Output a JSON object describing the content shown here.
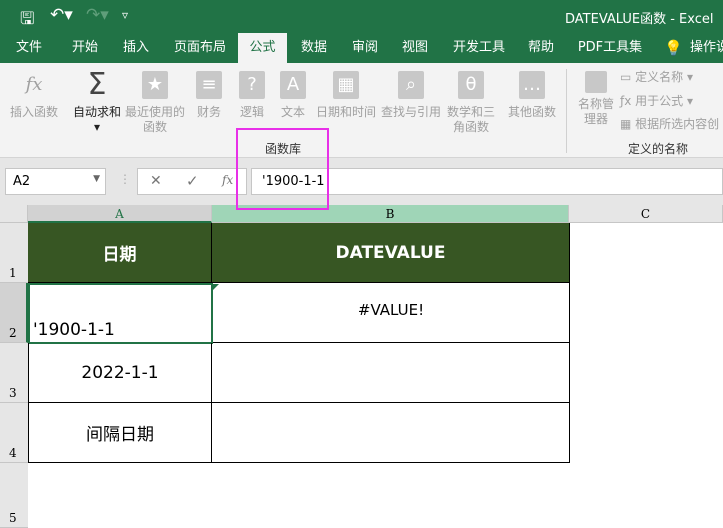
{
  "window": {
    "title": "DATEVALUE函数  -  Excel"
  },
  "qat": {
    "save": "save-icon",
    "undo": "undo-icon",
    "redo": "redo-icon",
    "customize": "▿"
  },
  "tabs": [
    {
      "label": "文件"
    },
    {
      "label": "开始"
    },
    {
      "label": "插入"
    },
    {
      "label": "页面布局"
    },
    {
      "label": "公式",
      "active": true
    },
    {
      "label": "数据"
    },
    {
      "label": "审阅"
    },
    {
      "label": "视图"
    },
    {
      "label": "开发工具"
    },
    {
      "label": "帮助"
    },
    {
      "label": "PDF工具集"
    },
    {
      "label": "操作说"
    }
  ],
  "ribbon": {
    "function_library": {
      "label": "函数库",
      "buttons": [
        {
          "label": "插入函数",
          "icon": "fx"
        },
        {
          "label": "自动求和",
          "icon": "Σ"
        },
        {
          "label": "最近使用的函数",
          "icon": "★"
        },
        {
          "label": "财务",
          "icon": "≡"
        },
        {
          "label": "逻辑",
          "icon": "?"
        },
        {
          "label": "文本",
          "icon": "A"
        },
        {
          "label": "日期和时间",
          "icon": "▦"
        },
        {
          "label": "查找与引用",
          "icon": "⌕"
        },
        {
          "label": "数学和三角函数",
          "icon": "θ"
        },
        {
          "label": "其他函数",
          "icon": "…"
        }
      ]
    },
    "defined_names": {
      "label": "定义的名称",
      "name_manager": "名称管理器",
      "define_name": "定义名称",
      "use_in_formula": "用于公式",
      "create_from_selection": "根据所选内容创"
    }
  },
  "formula_bar": {
    "name_box": "A2",
    "cancel": "✕",
    "enter": "✓",
    "fx": "fx",
    "content": "'1900-1-1"
  },
  "columns": [
    "A",
    "B",
    "C"
  ],
  "rows": [
    "1",
    "2",
    "3",
    "4",
    "5"
  ],
  "cells": {
    "A1": "日期",
    "B1": "DATEVALUE",
    "A2": "'1900-1-1",
    "B2": "#VALUE!",
    "A3": "2022-1-1",
    "A4": "间隔日期"
  },
  "colors": {
    "brand": "#217346",
    "header_fill": "#375623",
    "highlight": "#e830e8"
  }
}
